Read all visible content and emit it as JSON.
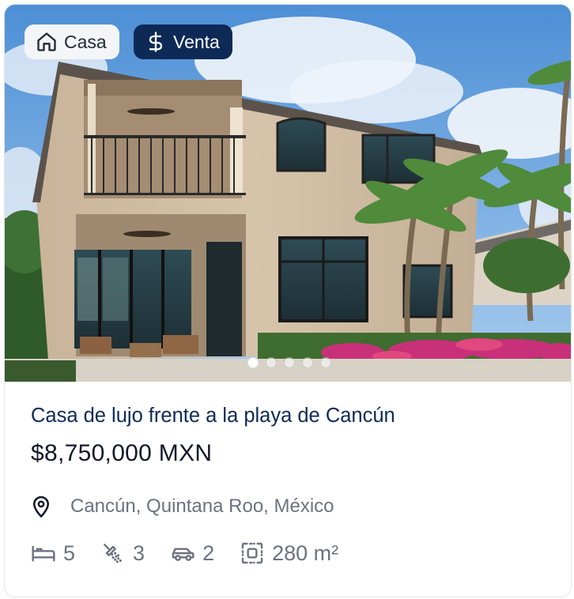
{
  "badges": {
    "type_label": "Casa",
    "operation_label": "Venta",
    "type_icon": "home-icon",
    "operation_icon": "dollar-icon"
  },
  "gallery": {
    "total_images": 5,
    "active_index": 0
  },
  "listing": {
    "title": "Casa de lujo frente a la playa de Cancún",
    "price": "$8,750,000 MXN",
    "location": "Cancún, Quintana Roo, México"
  },
  "features": {
    "bedrooms": "5",
    "bathrooms": "3",
    "parking": "2",
    "area": "280 m²"
  },
  "colors": {
    "brand_navy": "#0d2a57",
    "muted_text": "#6b7280",
    "badge_light": "#f4f5f7"
  }
}
